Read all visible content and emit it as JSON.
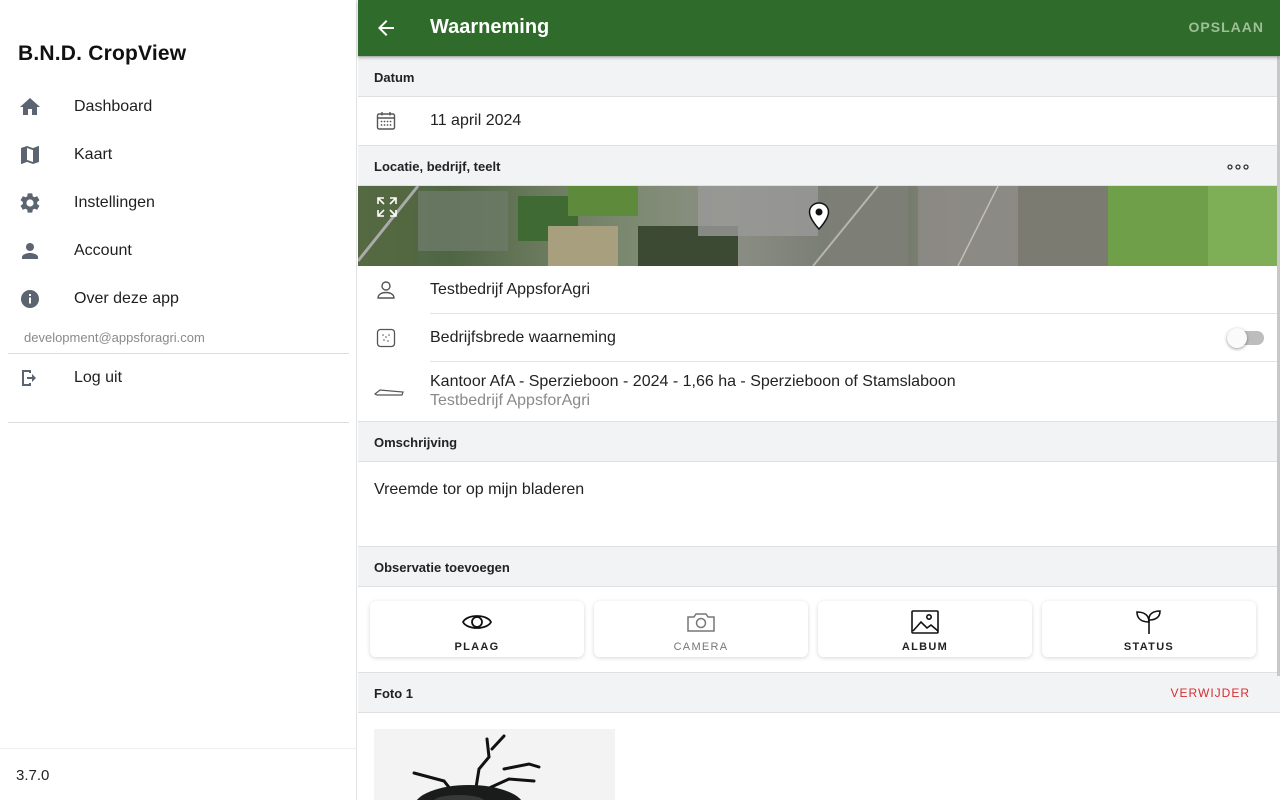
{
  "sidebar": {
    "app_title": "B.N.D. CropView",
    "items": [
      {
        "label": "Dashboard",
        "icon": "home-icon"
      },
      {
        "label": "Kaart",
        "icon": "map-icon"
      },
      {
        "label": "Instellingen",
        "icon": "gear-icon"
      },
      {
        "label": "Account",
        "icon": "person-icon"
      },
      {
        "label": "Over deze app",
        "icon": "info-icon"
      }
    ],
    "email": "development@appsforagri.com",
    "logout_label": "Log uit",
    "logout_icon": "logout-icon",
    "version": "3.7.0"
  },
  "appbar": {
    "title": "Waarneming",
    "save_label": "OPSLAAN",
    "color": "#2f6b2a"
  },
  "datum": {
    "header": "Datum",
    "value": "11 april 2024",
    "icon": "calendar-icon"
  },
  "location": {
    "header": "Locatie, bedrijf, teelt",
    "more_icon": "more-horizontal-icon",
    "company": "Testbedrijf AppsforAgri",
    "company_icon": "person-outline-icon",
    "company_wide_label": "Bedrijfsbrede waarneming",
    "company_wide_icon": "dotted-square-icon",
    "company_wide_enabled": false,
    "field_title": "Kantoor AfA - Sperzieboon - 2024 - 1,66 ha - Sperzieboon of Stamslaboon",
    "field_subtitle": "Testbedrijf AppsforAgri",
    "field_icon": "field-shape-icon"
  },
  "description": {
    "header": "Omschrijving",
    "text": "Vreemde tor op mijn bladeren"
  },
  "observation": {
    "header": "Observatie toevoegen",
    "buttons": [
      {
        "label": "PLAAG",
        "icon": "eye-icon",
        "enabled": true
      },
      {
        "label": "CAMERA",
        "icon": "camera-icon",
        "enabled": false
      },
      {
        "label": "ALBUM",
        "icon": "image-icon",
        "enabled": true
      },
      {
        "label": "STATUS",
        "icon": "sprout-icon",
        "enabled": true
      }
    ]
  },
  "photo": {
    "header": "Foto 1",
    "delete_label": "VERWIJDER",
    "delete_color": "#d32f2f"
  }
}
